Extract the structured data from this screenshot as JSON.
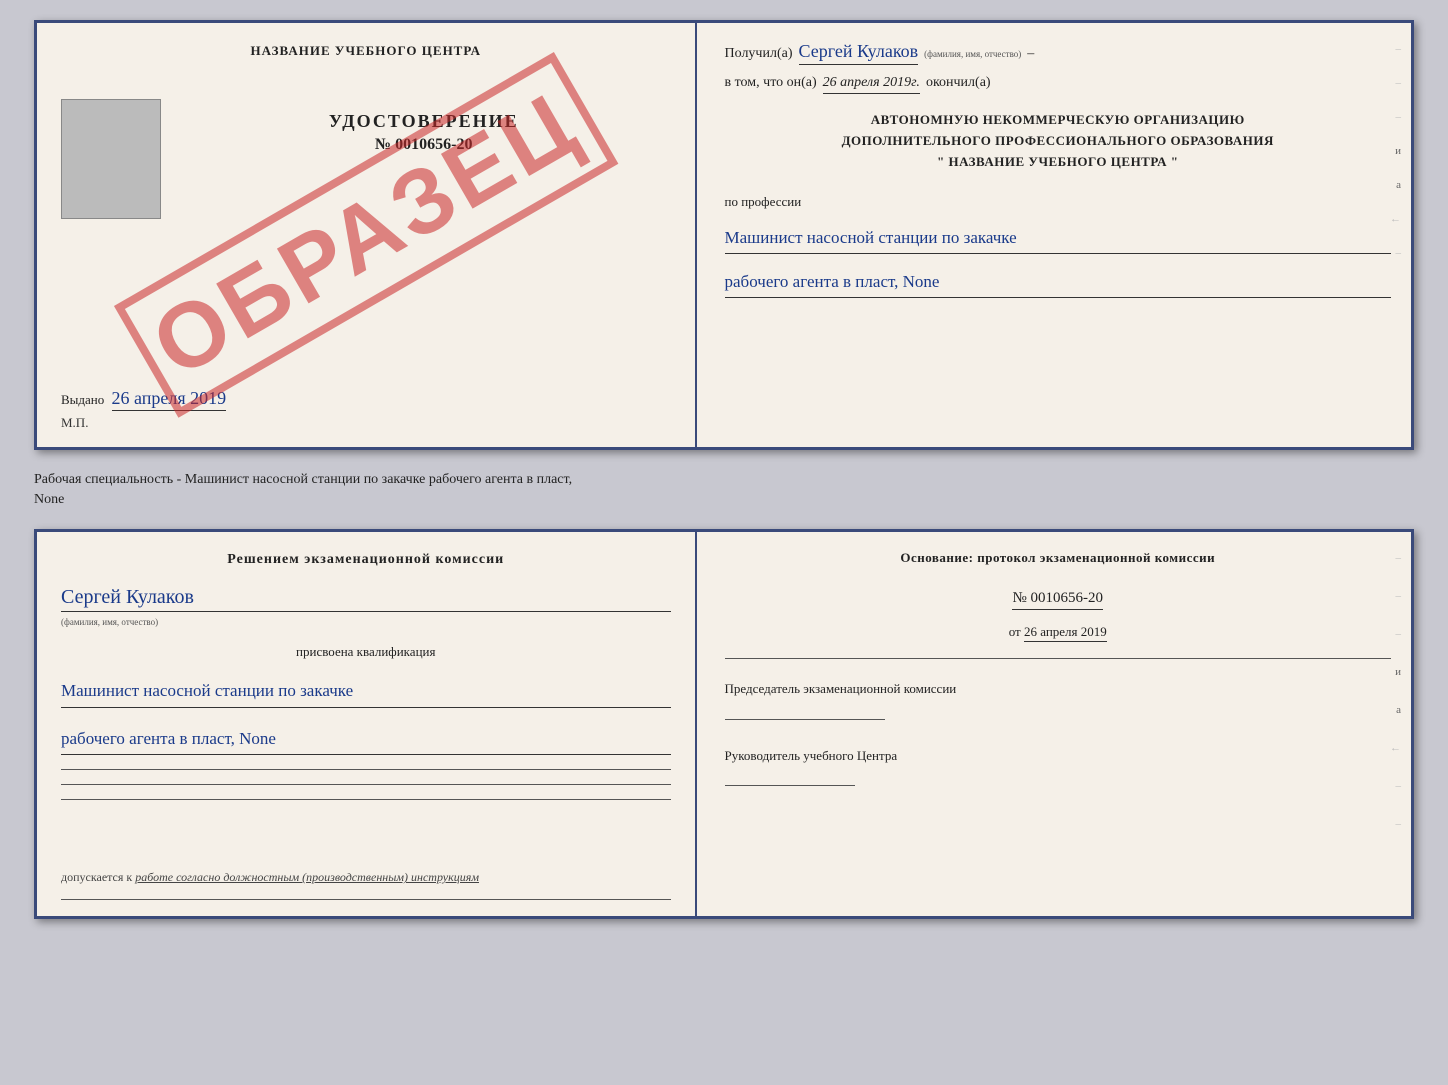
{
  "top_doc": {
    "left": {
      "title": "НАЗВАНИЕ УЧЕБНОГО ЦЕНТРА",
      "watermark": "ОБРАЗЕЦ",
      "udostoverenie": "УДОСТОВЕРЕНИЕ",
      "number": "№ 0010656-20",
      "vydano_label": "Выдано",
      "vydano_date": "26 апреля 2019",
      "mp": "М.П."
    },
    "right": {
      "poluchil_label": "Получил(а)",
      "poluchil_name": "Сергей Кулаков",
      "familiya_hint": "(фамилия, имя, отчество)",
      "dash": "–",
      "vtom_label": "в том, что он(а)",
      "vtom_date": "26 апреля 2019г.",
      "okonchil": "окончил(а)",
      "center_line1": "АВТОНОМНУЮ НЕКОММЕРЧЕСКУЮ ОРГАНИЗАЦИЮ",
      "center_line2": "ДОПОЛНИТЕЛЬНОГО ПРОФЕССИОНАЛЬНОГО ОБРАЗОВАНИЯ",
      "center_line3": "\"   НАЗВАНИЕ УЧЕБНОГО ЦЕНТРА   \"",
      "po_professii": "по профессии",
      "profession_line1": "Машинист насосной станции по закачке",
      "profession_line2": "рабочего агента в пласт, None"
    }
  },
  "between": {
    "text_line1": "Рабочая специальность - Машинист насосной станции по закачке рабочего агента в пласт,",
    "text_line2": "None"
  },
  "bottom_doc": {
    "left": {
      "komissia_title": "Решением экзаменационной комиссии",
      "person_name": "Сергей Кулаков",
      "familiya_hint": "(фамилия, имя, отчество)",
      "prisvoena": "присвоена квалификация",
      "qualification_line1": "Машинист насосной станции по закачке",
      "qualification_line2": "рабочего агента в пласт, None",
      "dopuskaetsya": "допускается к",
      "dopusk_val": "работе согласно должностным (производственным) инструкциям"
    },
    "right": {
      "osnovaniye": "Основание: протокол экзаменационной комиссии",
      "protocol_number": "№ 0010656-20",
      "ot_label": "от",
      "ot_date": "26 апреля 2019",
      "predsedatel_label": "Председатель экзаменационной комиссии",
      "rukovoditel_label": "Руководитель учебного Центра"
    }
  },
  "edge_marks": [
    "-",
    "-",
    "-",
    "и",
    "а",
    "←",
    "-",
    "-",
    "-"
  ]
}
